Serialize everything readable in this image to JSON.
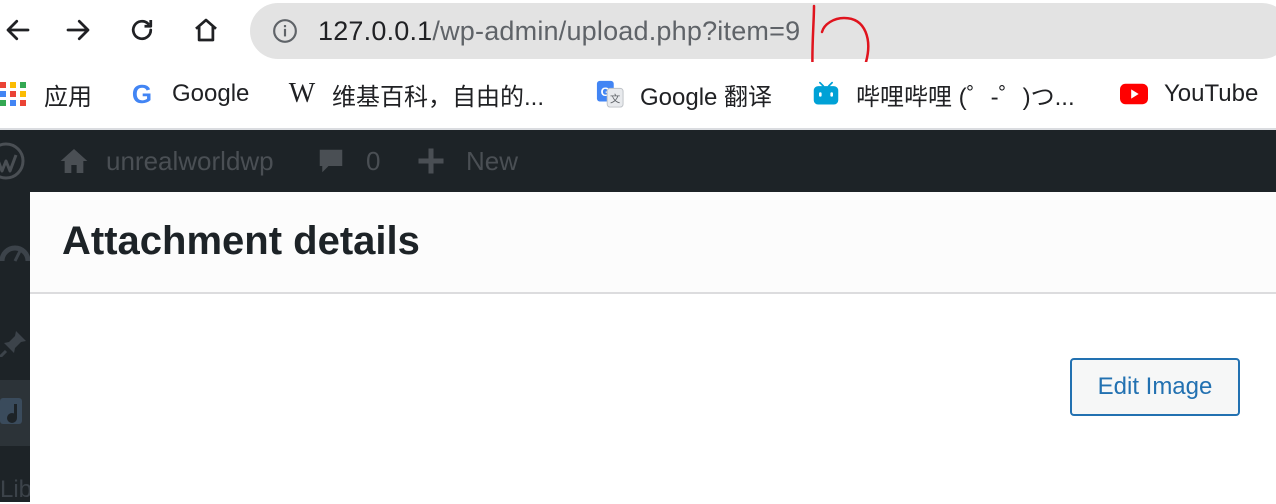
{
  "browser": {
    "url_host": "127.0.0.1",
    "url_path": "/wp-admin/upload.php?item=9",
    "icons": [
      "back-icon",
      "forward-icon",
      "reload-icon",
      "home-icon",
      "info-icon"
    ]
  },
  "bookmarks": [
    {
      "label": "应用",
      "icon": "apps-grid-icon"
    },
    {
      "label": "Google",
      "icon": "google-icon"
    },
    {
      "label": "维基百科，自由的...",
      "icon": "wikipedia-icon"
    },
    {
      "label": "Google 翻译",
      "icon": "google-translate-icon"
    },
    {
      "label": "哔哩哔哩 (゜-゜)つ...",
      "icon": "bilibili-icon"
    },
    {
      "label": "YouTube",
      "icon": "youtube-icon"
    }
  ],
  "adminbar": {
    "site_name": "unrealworldwp",
    "comments_count": "0",
    "new_label": "New"
  },
  "sidemenu": {
    "partial_label": "Lib"
  },
  "modal": {
    "title": "Attachment details",
    "edit_button": "Edit Image"
  },
  "colors": {
    "admin_bar": "#1d2327",
    "accent": "#2271b1",
    "annotation": "#e0141e"
  }
}
